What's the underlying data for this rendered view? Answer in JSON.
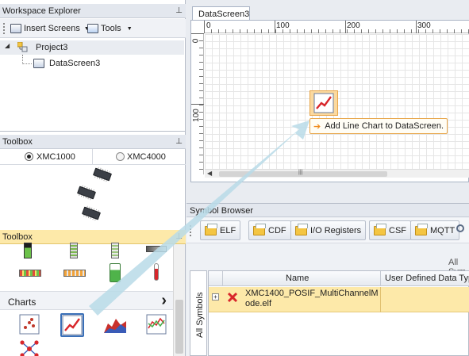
{
  "workspace_explorer": {
    "title": "Workspace Explorer",
    "pin_glyph": "⊥",
    "insert_screens_label": "Insert Screens",
    "tools_label": "Tools",
    "tree": {
      "project_label": "Project3",
      "screen_label": "DataScreen3",
      "expand_glyph": "◢"
    }
  },
  "toolbox_devices": {
    "title": "Toolbox",
    "pin_glyph": "⊥",
    "options": [
      {
        "label": "XMC1000",
        "selected": true
      },
      {
        "label": "XMC4000",
        "selected": false
      }
    ]
  },
  "toolbox_widgets": {
    "title": "Toolbox",
    "pin_glyph": "⊥",
    "category_label": "Charts",
    "category_arrow": "›",
    "chart_tools": [
      "scatter-chart",
      "line-chart",
      "area-chart",
      "multi-line-chart",
      "network-chart"
    ]
  },
  "document_tab": {
    "label": "DataScreen3"
  },
  "ruler": {
    "top_ticks": [
      "0",
      "100",
      "200",
      "300"
    ],
    "left_ticks": [
      "0",
      "100"
    ]
  },
  "drag_tooltip": {
    "arrow_glyph": "➔",
    "text": "Add Line Chart to DataScreen."
  },
  "symbol_browser": {
    "title": "Symbol Browser",
    "buttons": [
      "ELF",
      "CDF",
      "I/O Registers",
      "CSF",
      "MQTT"
    ],
    "filter_label": "All Sym",
    "side_tab": "All Symbols",
    "columns": [
      "Name",
      "User Defined Data Type"
    ],
    "rows": [
      {
        "expand": "+",
        "status": "error",
        "name": "XMC1400_POSIF_MultiChannelMode.elf"
      }
    ]
  },
  "colors": {
    "accent_orange": "#f7ba6a",
    "tooltip_border": "#e8a64a",
    "drag_arrow": "#b9dbe8",
    "error_red": "#d8262b",
    "selection_bg": "#fde9a9"
  }
}
